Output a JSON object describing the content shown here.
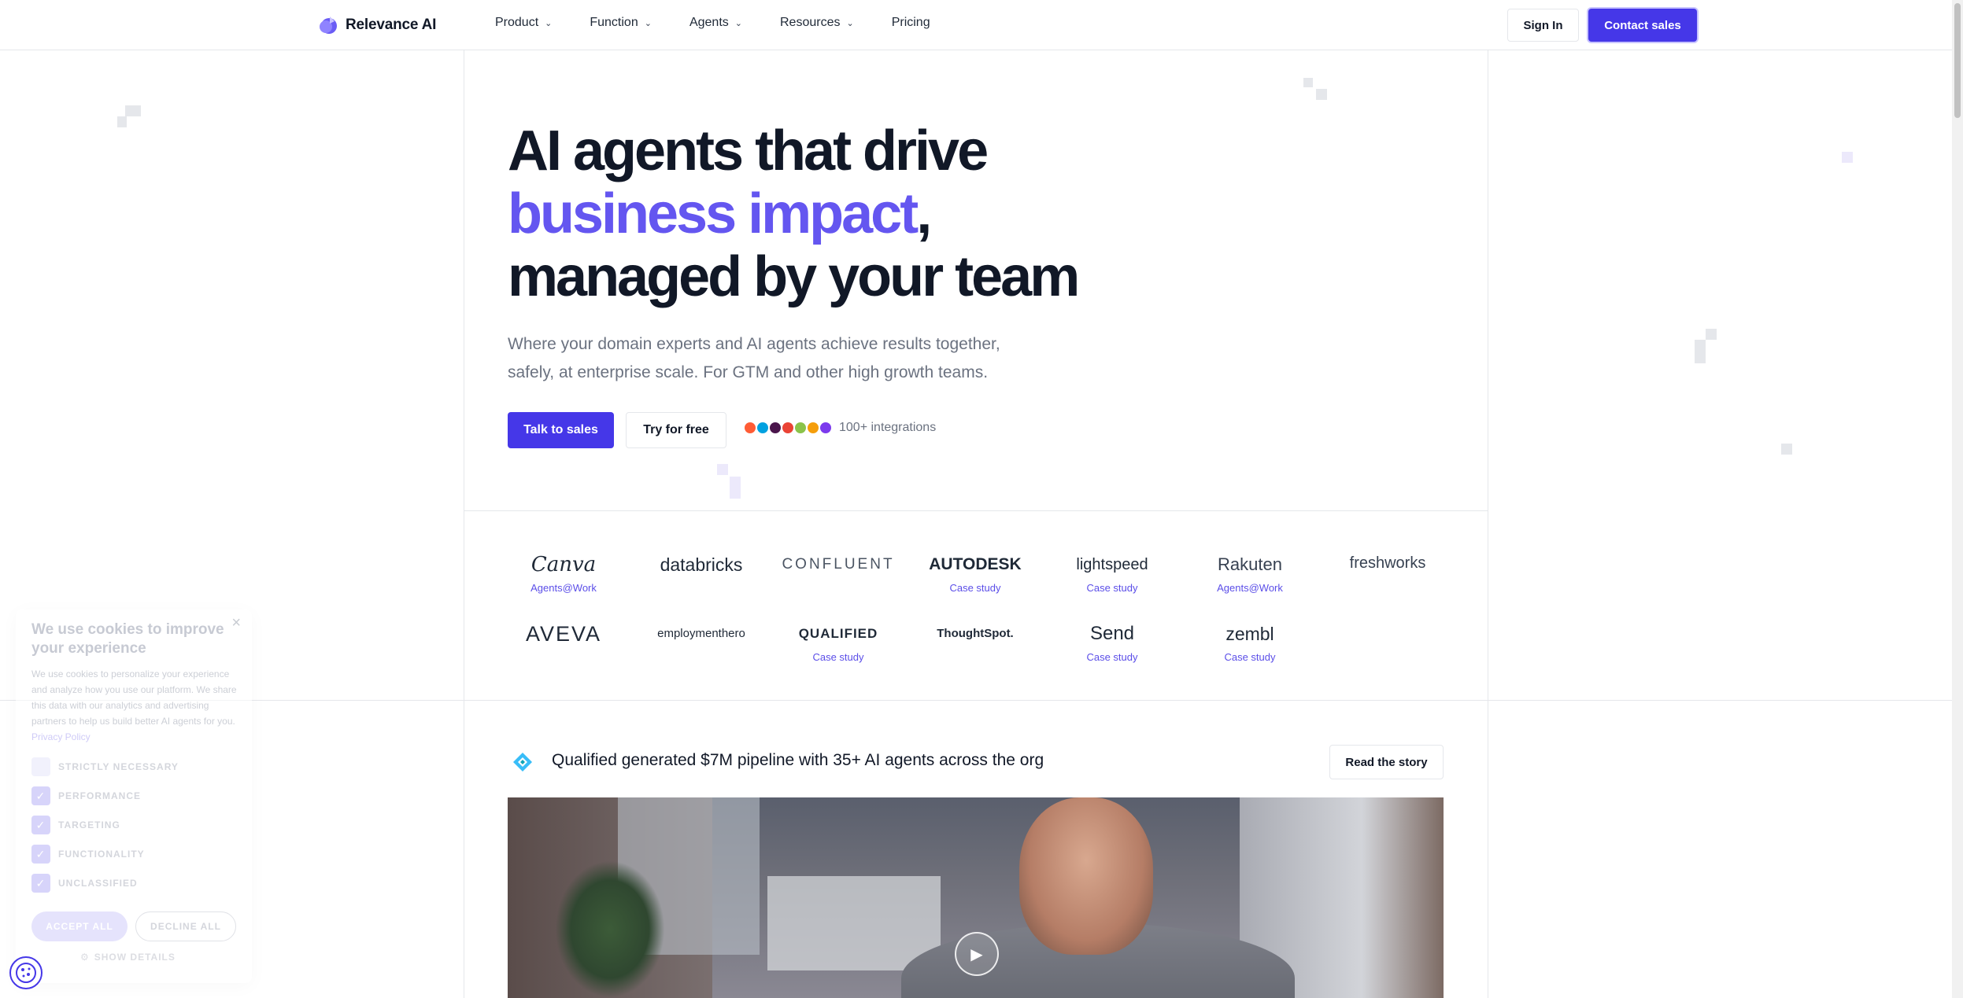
{
  "header": {
    "brand": "Relevance AI",
    "nav": [
      {
        "label": "Product",
        "has_dropdown": true
      },
      {
        "label": "Function",
        "has_dropdown": true
      },
      {
        "label": "Agents",
        "has_dropdown": true
      },
      {
        "label": "Resources",
        "has_dropdown": true
      },
      {
        "label": "Pricing",
        "has_dropdown": false
      }
    ],
    "sign_in": "Sign In",
    "contact_sales": "Contact sales"
  },
  "hero": {
    "title_line1": "AI agents that drive",
    "title_accent": "business impact",
    "title_comma": ",",
    "title_line3": "managed by your team",
    "subtitle_line1": "Where your domain experts and AI agents achieve results together,",
    "subtitle_line2": "safely, at enterprise scale. For GTM and other high growth teams.",
    "talk_to_sales": "Talk to sales",
    "try_free": "Try for free",
    "integrations": "100+ integrations"
  },
  "logos": {
    "row1": [
      {
        "name": "Canva",
        "link": "Agents@Work"
      },
      {
        "name": "databricks",
        "link": ""
      },
      {
        "name": "CONFLUENT",
        "link": ""
      },
      {
        "name": "AUTODESK",
        "link": "Case study"
      },
      {
        "name": "lightspeed",
        "link": "Case study"
      },
      {
        "name": "Rakuten",
        "link": "Agents@Work"
      },
      {
        "name": "freshworks",
        "link": ""
      }
    ],
    "row2": [
      {
        "name": "AVEVA",
        "link": ""
      },
      {
        "name": "employmenthero",
        "link": ""
      },
      {
        "name": "QUALIFIED",
        "link": "Case study"
      },
      {
        "name": "ThoughtSpot.",
        "link": ""
      },
      {
        "name": "Send",
        "link": "Case study"
      },
      {
        "name": "zembl",
        "link": "Case study"
      }
    ]
  },
  "story": {
    "text": "Qualified generated $7M pipeline with 35+ AI agents across the org",
    "read_button": "Read the story"
  },
  "cookie": {
    "title": "We use cookies to improve your experience",
    "body": "We use cookies to personalize your experience and analyze how you use our platform. We share this data with our analytics and advertising partners to help us build better AI agents for you.",
    "privacy_link": "Privacy Policy",
    "options": [
      {
        "label": "STRICTLY NECESSARY",
        "checked": false
      },
      {
        "label": "PERFORMANCE",
        "checked": true
      },
      {
        "label": "TARGETING",
        "checked": true
      },
      {
        "label": "FUNCTIONALITY",
        "checked": true
      },
      {
        "label": "UNCLASSIFIED",
        "checked": true
      }
    ],
    "accept_all": "ACCEPT ALL",
    "decline_all": "DECLINE ALL",
    "show_details": "SHOW DETAILS"
  },
  "colors": {
    "accent": "#4537e8",
    "accent_text": "#6456f0",
    "link": "#5b4ee8"
  }
}
